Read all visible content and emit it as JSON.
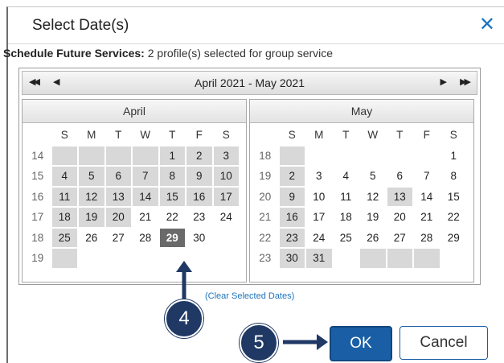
{
  "dialog": {
    "title": "Select Date(s)",
    "close_glyph": "✕",
    "subtitle_label": "Schedule Future Services:",
    "subtitle_text": " 2 profile(s) selected for group service"
  },
  "calendar": {
    "range_label": "April 2021 - May 2021",
    "nav": {
      "first": "◀◀",
      "prev": "◀",
      "next": "▶",
      "last": "▶▶"
    },
    "weekday_headers": [
      "S",
      "M",
      "T",
      "W",
      "T",
      "F",
      "S"
    ],
    "months": [
      {
        "name": "April",
        "weeks": [
          {
            "wk": "14",
            "days": [
              "",
              "",
              "",
              "",
              "1",
              "2",
              "3"
            ]
          },
          {
            "wk": "15",
            "days": [
              "4",
              "5",
              "6",
              "7",
              "8",
              "9",
              "10"
            ]
          },
          {
            "wk": "16",
            "days": [
              "11",
              "12",
              "13",
              "14",
              "15",
              "16",
              "17"
            ]
          },
          {
            "wk": "17",
            "days": [
              "18",
              "19",
              "20",
              "21",
              "22",
              "23",
              "24"
            ]
          },
          {
            "wk": "18",
            "days": [
              "25",
              "26",
              "27",
              "28",
              "29",
              "30",
              ""
            ]
          },
          {
            "wk": "19",
            "days": [
              "",
              "",
              "",
              "",
              "",
              "",
              ""
            ]
          }
        ]
      },
      {
        "name": "May",
        "weeks": [
          {
            "wk": "18",
            "days": [
              "",
              "",
              "",
              "",
              "",
              "",
              "1"
            ]
          },
          {
            "wk": "19",
            "days": [
              "2",
              "3",
              "4",
              "5",
              "6",
              "7",
              "8"
            ]
          },
          {
            "wk": "20",
            "days": [
              "9",
              "10",
              "11",
              "12",
              "13",
              "14",
              "15"
            ]
          },
          {
            "wk": "21",
            "days": [
              "16",
              "17",
              "18",
              "19",
              "20",
              "21",
              "22"
            ]
          },
          {
            "wk": "22",
            "days": [
              "23",
              "24",
              "25",
              "26",
              "27",
              "28",
              "29"
            ]
          },
          {
            "wk": "23",
            "days": [
              "30",
              "31",
              "",
              "",
              "",
              "",
              ""
            ]
          }
        ]
      }
    ],
    "selected_date": "April 29",
    "clear_link": "(Clear Selected Dates)"
  },
  "annotations": {
    "step4": "4",
    "step5": "5"
  },
  "buttons": {
    "ok": "OK",
    "cancel": "Cancel"
  },
  "colors": {
    "accent": "#1a5fa6",
    "marker": "#1f3864",
    "disabled_cell": "#d8d8d8",
    "selected_cell": "#6a6a6a"
  }
}
